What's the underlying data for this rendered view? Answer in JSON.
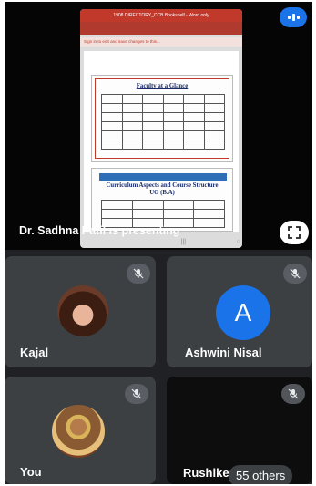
{
  "slide": {
    "top_bar": "1908 DIRECTORY_CCB Bookshelf - Word only",
    "message": "Sign in to edit and save changes to this...",
    "page1_title": "Faculty at a Glance",
    "page2_title_line1": "Curriculum Aspects and Course Structure",
    "page2_title_line2": "UG (B.A)"
  },
  "presenter": {
    "label": "Dr. Sadhna Patil is presenting"
  },
  "participants": [
    {
      "name": "Kajal"
    },
    {
      "name": "Ashwini Nisal",
      "initial": "A"
    },
    {
      "name": "You"
    },
    {
      "name": "Rushikesh"
    }
  ],
  "others_count": "55 others",
  "colors": {
    "background": "#202124",
    "tile": "#3c4043",
    "accent": "#1a73e8"
  },
  "icons": {
    "muted": "mic-off-icon",
    "fullscreen": "fullscreen-icon",
    "presenter": "audio-level-icon"
  }
}
